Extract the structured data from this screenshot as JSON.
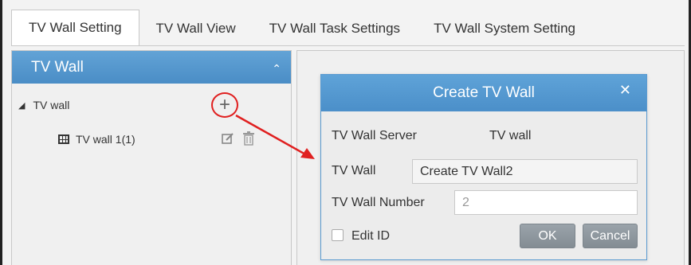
{
  "tabs": [
    {
      "label": "TV Wall Setting"
    },
    {
      "label": "TV Wall View"
    },
    {
      "label": "TV Wall Task Settings"
    },
    {
      "label": "TV Wall System Setting"
    }
  ],
  "left_panel": {
    "title": "TV Wall",
    "collapse_icon": "chevron-up-icon",
    "tree": {
      "root_label": "TV wall",
      "children": [
        {
          "label": "TV wall 1(1)"
        }
      ]
    }
  },
  "dialog": {
    "title": "Create TV Wall",
    "close_icon": "close-icon",
    "server_label": "TV Wall Server",
    "server_value": "TV wall",
    "wall_label": "TV Wall",
    "wall_value": "Create TV Wall2",
    "number_label": "TV Wall Number",
    "number_value": "2",
    "edit_id_label": "Edit ID",
    "ok_label": "OK",
    "cancel_label": "Cancel"
  },
  "colors": {
    "header_blue": "#4b8fc9",
    "annotation_red": "#e02020",
    "button_gray": "#8a939a"
  }
}
